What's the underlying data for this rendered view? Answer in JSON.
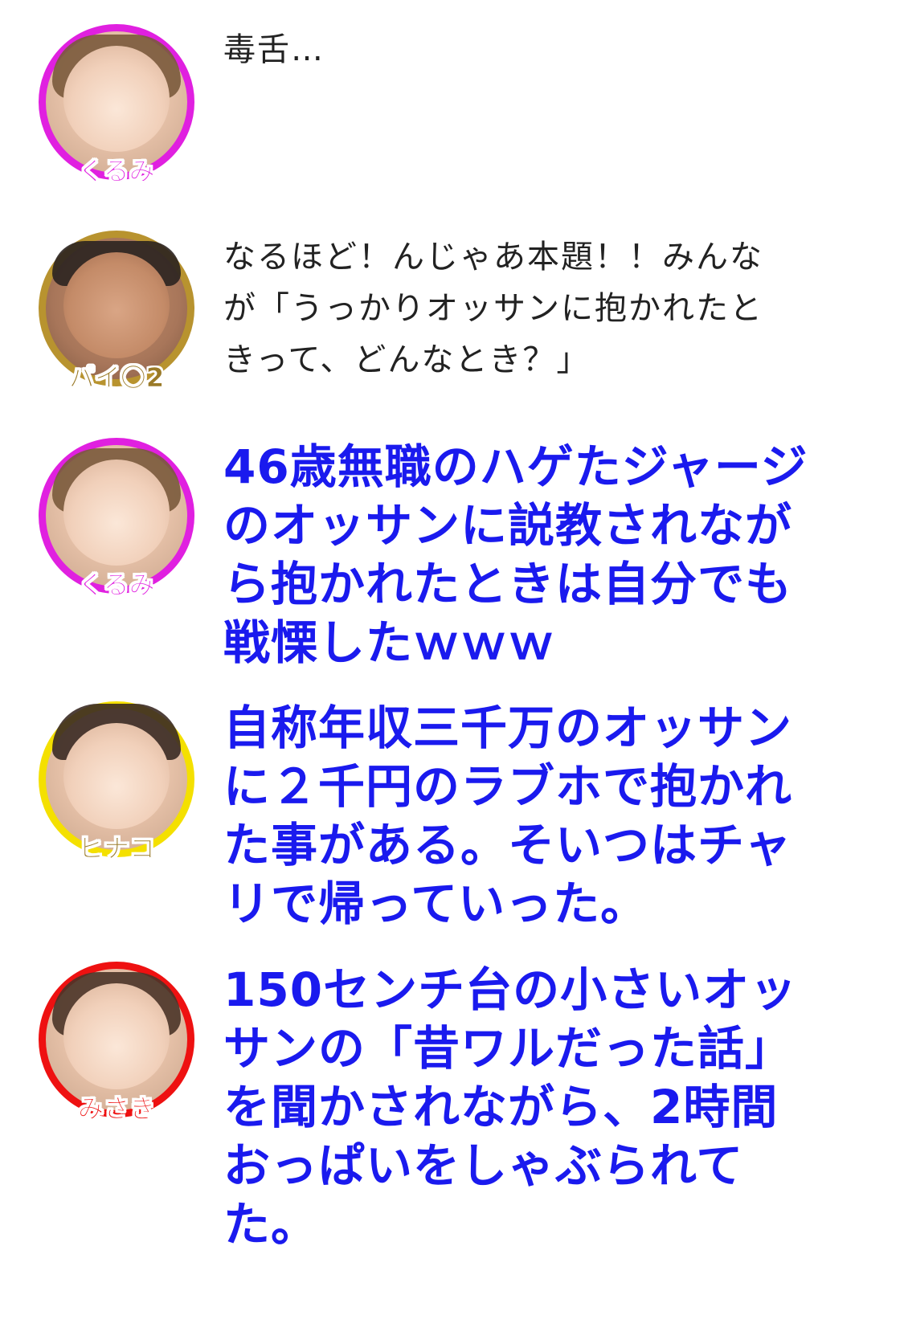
{
  "messages": [
    {
      "speaker": "くるみ",
      "ring_color": "#e020e0",
      "style": "normal",
      "text": "毒舌…"
    },
    {
      "speaker": "パイ〇2",
      "ring_color": "#b8932f",
      "style": "normal",
      "text": "なるほど！んじゃあ本題！！みんな\nが「うっかりオッサンに抱かれたと\nきって、どんなとき？」"
    },
    {
      "speaker": "くるみ",
      "ring_color": "#e020e0",
      "style": "emphasis",
      "text": "46歳無職のハゲたジャージ\nのオッサンに説教されなが\nら抱かれたときは自分でも\n戦慄したｗｗｗ"
    },
    {
      "speaker": "ヒナコ",
      "ring_color": "#f4e000",
      "style": "emphasis",
      "text": "自称年収三千万のオッサン\nに２千円のラブホで抱かれ\nた事がある。そいつはチャ\nリで帰っていった。"
    },
    {
      "speaker": "みさき",
      "ring_color": "#ee1111",
      "style": "emphasis",
      "text": "150センチ台の小さいオッ\nサンの「昔ワルだった話」\nを聞かされながら、2時間\nおっぱいをしゃぶられて\nた。"
    }
  ],
  "colors": {
    "normal_text": "#222222",
    "emphasis_text": "#1a1aee",
    "background": "#ffffff"
  }
}
